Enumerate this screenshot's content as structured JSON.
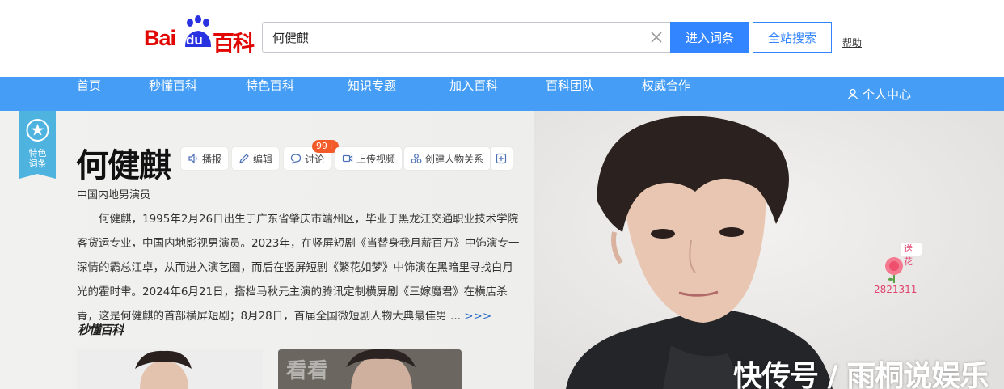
{
  "header": {
    "logo_text": "Bai du 百科",
    "search_value": "何健麒",
    "enter_button": "进入词条",
    "site_search_button": "全站搜索",
    "help_link": "帮助"
  },
  "nav": {
    "items": [
      "首页",
      "秒懂百科",
      "特色百科",
      "知识专题",
      "加入百科",
      "百科团队",
      "权威合作"
    ],
    "user_center": "个人中心"
  },
  "badge": {
    "label": "特色词条"
  },
  "entry": {
    "title": "何健麒",
    "subtitle": "中国内地男演员",
    "summary": "何健麒，1995年2月26日出生于广东省肇庆市端州区，毕业于黑龙江交通职业技术学院客货运专业，中国内地影视男演员。2023年，在竖屏短剧《当替身我月薪百万》中饰演专一深情的霸总江卓，从而进入演艺圈，而后在竖屏短剧《繁花如梦》中饰演在黑暗里寻找白月光的霍时聿。2024年6月21日，搭档马秋元主演的腾讯定制横屏剧《三嫁魔君》在横店杀青，这是何健麒的首部横屏短剧；8月28日，首届全国微短剧人物大典最佳男 ...",
    "more": ">>>"
  },
  "toolbar": {
    "broadcast": "播报",
    "edit": "编辑",
    "discuss": "讨论",
    "discuss_count": "99+",
    "upload_video": "上传视频",
    "relations": "创建人物关系"
  },
  "miaodong": {
    "logo_text": "秒懂百科",
    "thumb_text": "看看"
  },
  "flower": {
    "send": "送花",
    "count": "2821311"
  },
  "watermark": "快传号 / 雨桐说娱乐",
  "colors": {
    "brand_red": "#e10602",
    "accent_blue": "#3385ff",
    "nav_blue": "#459df5",
    "badge_teal": "#4fb3e0"
  },
  "icons": [
    "clear-icon",
    "speaker-icon",
    "pencil-icon",
    "chat-icon",
    "video-icon",
    "relation-icon",
    "plus-icon",
    "user-icon",
    "star-badge-icon",
    "rose-icon"
  ]
}
